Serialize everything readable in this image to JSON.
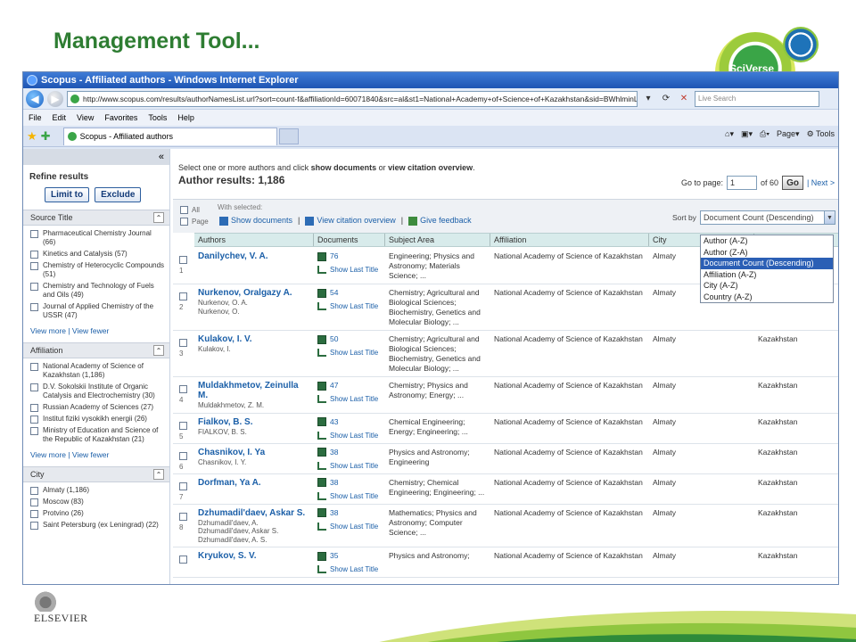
{
  "slide": {
    "title": "Management Tool..."
  },
  "brand": {
    "sciverse": "SciVerse",
    "elsevier": "ELSEVIER"
  },
  "browser": {
    "window_title": "Scopus - Affiliated authors - Windows Internet Explorer",
    "url": "http://www.scopus.com/results/authorNamesList.url?sort=count-f&affiliationId=60071840&src=al&st1=National+Academy+of+Science+of+Kazakhstan&sid=BWhlminLb8lc7tqt0",
    "search_placeholder": "Live Search",
    "menu": [
      "File",
      "Edit",
      "View",
      "Favorites",
      "Tools",
      "Help"
    ],
    "tab_title": "Scopus - Affiliated authors",
    "toolbar": {
      "page": "Page",
      "tools": "Tools"
    }
  },
  "sidebar": {
    "refine_title": "Refine results",
    "limit_label": "Limit to",
    "exclude_label": "Exclude",
    "facets": [
      {
        "title": "Source Title",
        "items": [
          "Pharmaceutical Chemistry Journal (66)",
          "Kinetics and Catalysis (57)",
          "Chemistry of Heterocyclic Compounds (51)",
          "Chemistry and Technology of Fuels and Oils (49)",
          "Journal of Applied Chemistry of the USSR (47)"
        ],
        "more": "View more | View fewer"
      },
      {
        "title": "Affiliation",
        "items": [
          "National Academy of Science of Kazakhstan (1,186)",
          "D.V. Sokolskii Institute of Organic Catalysis and Electrochemistry (30)",
          "Russian Academy of Sciences (27)",
          "Institut fiziki vysokikh energii (26)",
          "Ministry of Education and Science of the Republic of Kazakhstan (21)"
        ],
        "more": "View more | View fewer"
      },
      {
        "title": "City",
        "items": [
          "Almaty (1,186)",
          "Moscow (83)",
          "Protvino (26)",
          "Saint Petersburg (ex Leningrad) (22)"
        ],
        "more": ""
      }
    ]
  },
  "results": {
    "hint_pre": "Select one or more authors and click ",
    "hint_b1": "show documents",
    "hint_mid": " or ",
    "hint_b2": "view citation overview",
    "hint_post": ".",
    "count_label": "Author results: 1,186",
    "goto_label": "Go to page:",
    "goto_value": "1",
    "of_pages": "of 60",
    "go": "Go",
    "next": "| Next >",
    "all_label": "All",
    "page_label": "Page",
    "with_selected": "With selected:",
    "show_documents": "Show documents",
    "view_citation": "View citation overview",
    "give_feedback": "Give feedback",
    "sort_label": "Sort by",
    "sort_selected": "Document Count (Descending)",
    "sort_options": [
      "Author (A-Z)",
      "Author (Z-A)",
      "Document Count (Descending)",
      "Affiliation (A-Z)",
      "City (A-Z)",
      "Country (A-Z)"
    ],
    "columns": [
      "Authors",
      "Documents",
      "Subject Area",
      "Affiliation",
      "City",
      ""
    ],
    "show_last_title": "Show Last Title",
    "rows": [
      {
        "n": "1",
        "name": "Danilychev, V. A.",
        "variants": [],
        "docs": "76",
        "subject": "Engineering; Physics and Astronomy; Materials Science; ...",
        "affiliation": "National Academy of Science of Kazakhstan",
        "city": "Almaty",
        "country": ""
      },
      {
        "n": "2",
        "name": "Nurkenov, Oralgazy A.",
        "variants": [
          "Nurkenov, O. A.",
          "Nurkenov, O."
        ],
        "docs": "54",
        "subject": "Chemistry; Agricultural and Biological Sciences; Biochemistry, Genetics and Molecular Biology; ...",
        "affiliation": "National Academy of Science of Kazakhstan",
        "city": "Almaty",
        "country": "Kazakhstan"
      },
      {
        "n": "3",
        "name": "Kulakov, I. V.",
        "variants": [
          "Kulakov, I."
        ],
        "docs": "50",
        "subject": "Chemistry; Agricultural and Biological Sciences; Biochemistry, Genetics and Molecular Biology; ...",
        "affiliation": "National Academy of Science of Kazakhstan",
        "city": "Almaty",
        "country": "Kazakhstan"
      },
      {
        "n": "4",
        "name": "Muldakhmetov, Zeinulla M.",
        "variants": [
          "Muldakhmetov, Z. M."
        ],
        "docs": "47",
        "subject": "Chemistry; Physics and Astronomy; Energy; ...",
        "affiliation": "National Academy of Science of Kazakhstan",
        "city": "Almaty",
        "country": "Kazakhstan"
      },
      {
        "n": "5",
        "name": "Fialkov, B. S.",
        "variants": [
          "FIALKOV, B. S."
        ],
        "docs": "43",
        "subject": "Chemical Engineering; Energy; Engineering; ...",
        "affiliation": "National Academy of Science of Kazakhstan",
        "city": "Almaty",
        "country": "Kazakhstan"
      },
      {
        "n": "6",
        "name": "Chasnikov, I. Ya",
        "variants": [
          "Chasnikov, I. Y."
        ],
        "docs": "38",
        "subject": "Physics and Astronomy; Engineering",
        "affiliation": "National Academy of Science of Kazakhstan",
        "city": "Almaty",
        "country": "Kazakhstan"
      },
      {
        "n": "7",
        "name": "Dorfman, Ya A.",
        "variants": [],
        "docs": "38",
        "subject": "Chemistry; Chemical Engineering; Engineering; ...",
        "affiliation": "National Academy of Science of Kazakhstan",
        "city": "Almaty",
        "country": "Kazakhstan"
      },
      {
        "n": "8",
        "name": "Dzhumadil'daev, Askar S.",
        "variants": [
          "Dzhumadil'daev, A.",
          "Dzhumadil'daev, Askar S.",
          "Dzhumadil'daev, A. S."
        ],
        "docs": "38",
        "subject": "Mathematics; Physics and Astronomy; Computer Science; ...",
        "affiliation": "National Academy of Science of Kazakhstan",
        "city": "Almaty",
        "country": "Kazakhstan"
      },
      {
        "n": "",
        "name": "Kryukov, S. V.",
        "variants": [],
        "docs": "35",
        "subject": "Physics and Astronomy;",
        "affiliation": "National Academy of Science of Kazakhstan",
        "city": "Almaty",
        "country": "Kazakhstan"
      }
    ]
  }
}
